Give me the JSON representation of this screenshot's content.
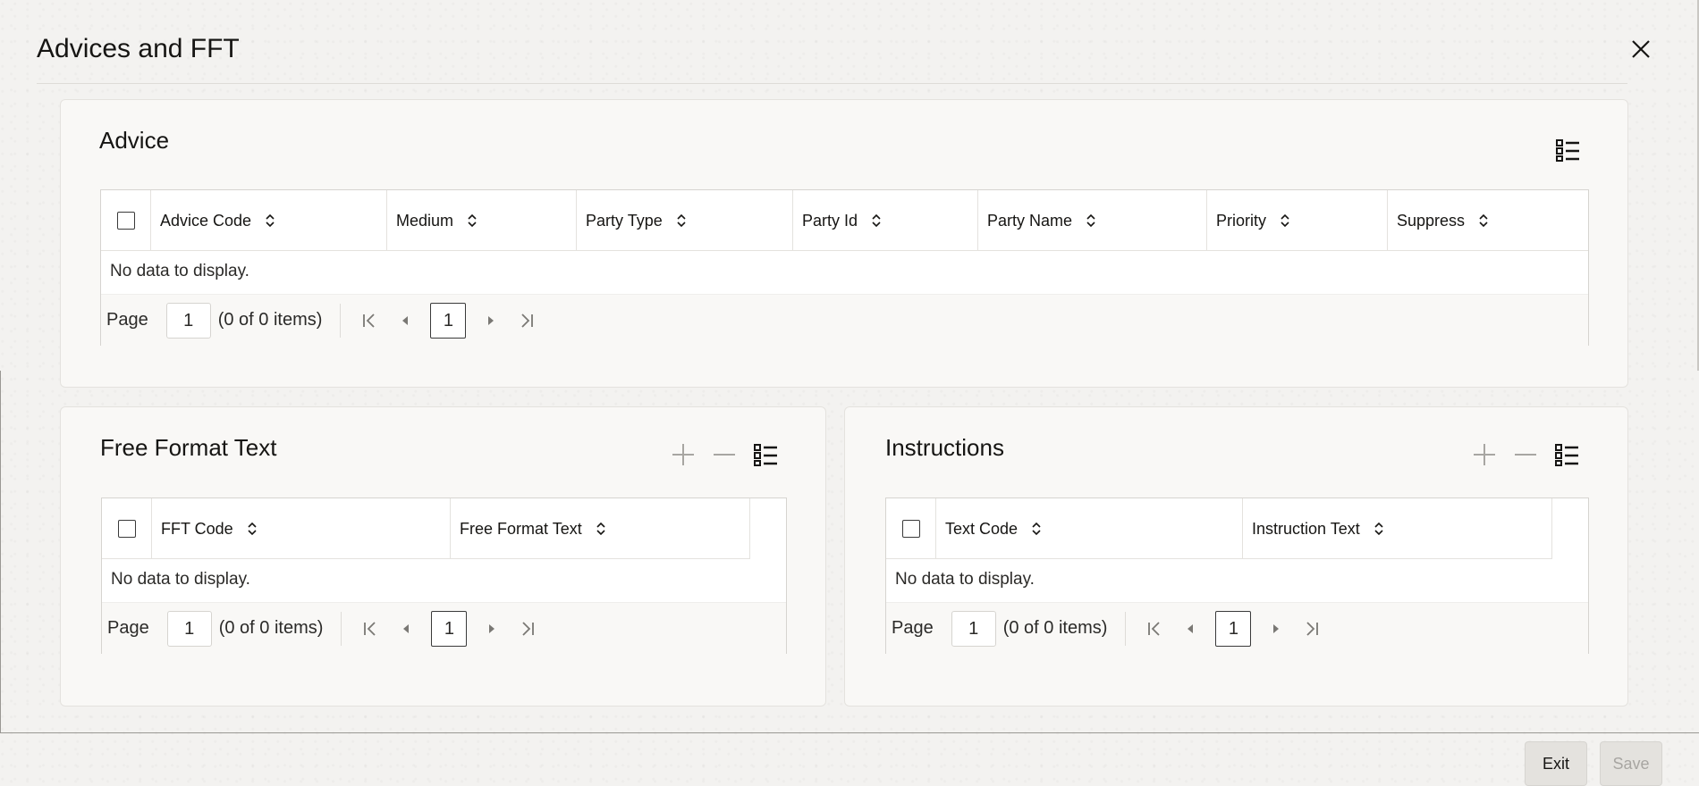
{
  "dialog": {
    "title": "Advices and FFT",
    "close_icon": "close-icon"
  },
  "advice": {
    "title": "Advice",
    "columns": [
      "Advice Code",
      "Medium",
      "Party Type",
      "Party Id",
      "Party Name",
      "Priority",
      "Suppress"
    ],
    "empty_text": "No data to display.",
    "pager": {
      "page_label": "Page",
      "page_value": "1",
      "items_text": "(0 of 0 items)",
      "current_page": "1"
    }
  },
  "fft": {
    "title": "Free Format Text",
    "columns": [
      "FFT Code",
      "Free Format Text"
    ],
    "empty_text": "No data to display.",
    "pager": {
      "page_label": "Page",
      "page_value": "1",
      "items_text": "(0 of 0 items)",
      "current_page": "1"
    }
  },
  "instructions": {
    "title": "Instructions",
    "columns": [
      "Text Code",
      "Instruction Text"
    ],
    "empty_text": "No data to display.",
    "pager": {
      "page_label": "Page",
      "page_value": "1",
      "items_text": "(0 of 0 items)",
      "current_page": "1"
    }
  },
  "footer": {
    "exit_label": "Exit",
    "save_label": "Save"
  },
  "colors": {
    "text": "#161513",
    "border": "#d6d4d0",
    "card_bg": "#f9f8f6",
    "disabled_text": "#a8a6a2"
  }
}
